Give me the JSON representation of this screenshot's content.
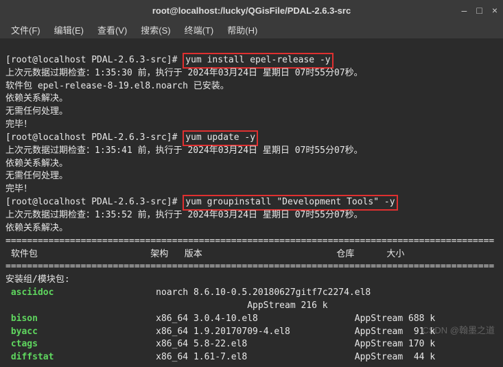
{
  "titlebar": {
    "title": "root@localhost:/lucky/QGisFile/PDAL-2.6.3-src",
    "minimize": "–",
    "maximize": "□",
    "close": "×"
  },
  "menubar": {
    "file": "文件(F)",
    "edit": "编辑(E)",
    "view": "查看(V)",
    "search": "搜索(S)",
    "terminal": "终端(T)",
    "help": "帮助(H)"
  },
  "term": {
    "prompt": "[root@localhost PDAL-2.6.3-src]# ",
    "cmd1": "yum install epel-release -y",
    "meta1": "上次元数据过期检查：1:35:30 前，执行于 2024年03月24日 星期日 07时55分07秒。",
    "pkg_installed": "软件包 epel-release-8-19.el8.noarch 已安装。",
    "dep_resolved": "依赖关系解决。",
    "no_action": "无需任何处理。",
    "done": "完毕！",
    "cmd2": "yum update -y",
    "meta2": "上次元数据过期检查：1:35:41 前，执行于 2024年03月24日 星期日 07时55分07秒。",
    "cmd3": "yum groupinstall \"Development Tools\" -y",
    "meta3": "上次元数据过期检查：1:35:52 前，执行于 2024年03月24日 星期日 07时55分07秒。",
    "sep_line": "===========================================================================================",
    "header_pkg": " 软件包",
    "header_arch": "架构",
    "header_ver": "版本",
    "header_repo": "仓库",
    "header_size": "大小",
    "group_label": "安装组/模块包:",
    "rows": [
      {
        "name": " asciidoc",
        "rest": "noarch 8.6.10-0.5.20180627gitf7c2274.el8"
      },
      {
        "name": "",
        "rest": "                                             AppStream 216 k"
      },
      {
        "name": " bison",
        "rest": "x86_64 3.0.4-10.el8                  AppStream 688 k"
      },
      {
        "name": " byacc",
        "rest": "x86_64 1.9.20170709-4.el8            AppStream  91 k"
      },
      {
        "name": " ctags",
        "rest": "x86_64 5.8-22.el8                    AppStream 170 k"
      },
      {
        "name": " diffstat",
        "rest": "x86_64 1.61-7.el8                    AppStream  44 k"
      }
    ]
  },
  "watermark": "CSDN @翰墨之道"
}
